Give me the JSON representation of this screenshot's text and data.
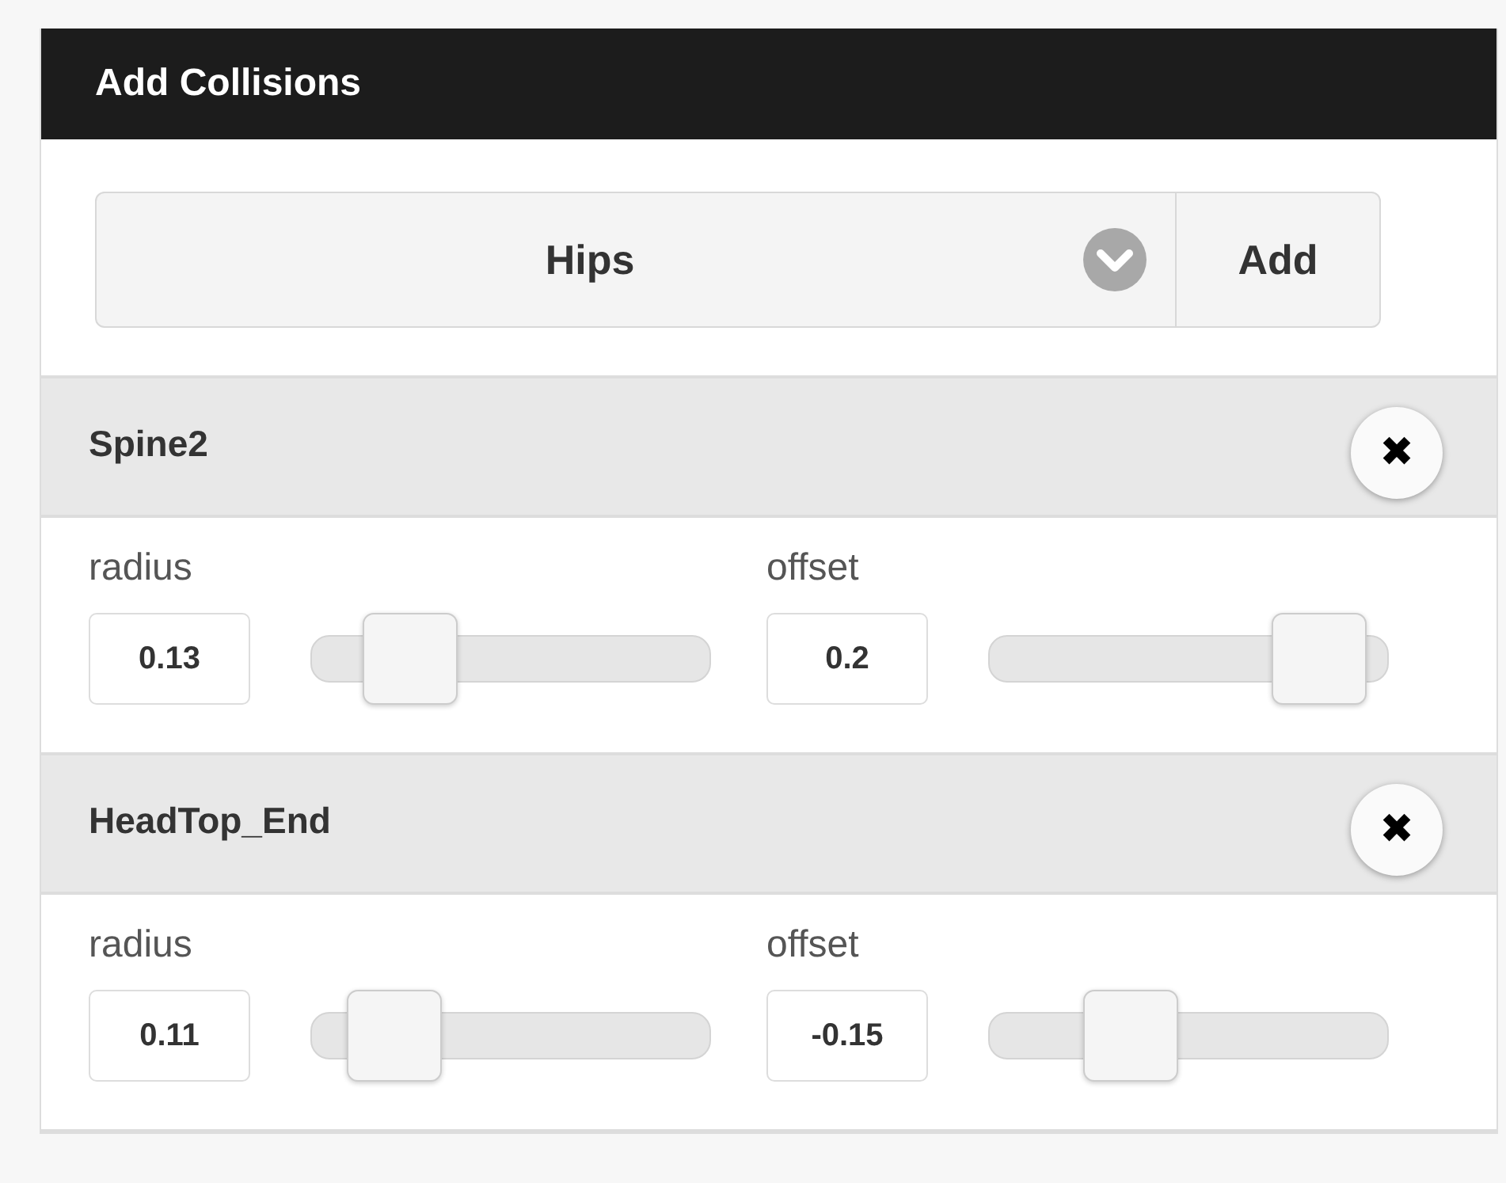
{
  "panel": {
    "title": "Add Collisions"
  },
  "bone_select": {
    "value": "Hips",
    "add_label": "Add"
  },
  "collisions": [
    {
      "name": "Spine2",
      "close": "✖",
      "params": [
        {
          "label": "radius",
          "value": "0.13",
          "level": 0.17
        },
        {
          "label": "offset",
          "value": "0.2",
          "level": 0.93
        }
      ]
    },
    {
      "name": "HeadTop_End",
      "close": "✖",
      "params": [
        {
          "label": "radius",
          "value": "0.11",
          "level": 0.12
        },
        {
          "label": "offset",
          "value": "-0.15",
          "level": 0.31
        }
      ]
    }
  ]
}
